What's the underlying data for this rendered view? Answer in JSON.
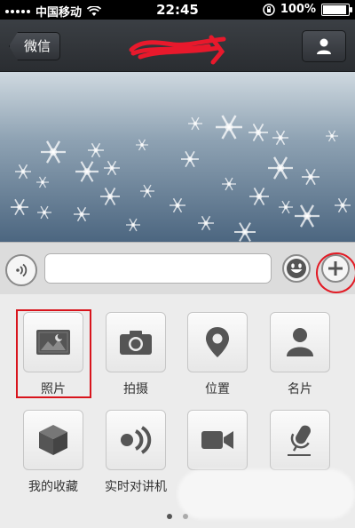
{
  "status_bar": {
    "carrier": "中国移动",
    "time": "22:45",
    "battery_percent": "100%",
    "battery_level": 1.0
  },
  "nav": {
    "back_label": "微信"
  },
  "input": {
    "placeholder": "",
    "value": ""
  },
  "panel": {
    "items": [
      {
        "label": "照片",
        "icon": "photo-icon"
      },
      {
        "label": "拍摄",
        "icon": "camera-icon"
      },
      {
        "label": "位置",
        "icon": "location-pin-icon"
      },
      {
        "label": "名片",
        "icon": "contact-card-icon"
      },
      {
        "label": "我的收藏",
        "icon": "favorites-cube-icon"
      },
      {
        "label": "实时对讲机",
        "icon": "walkie-talkie-icon"
      },
      {
        "label": "",
        "icon": "video-camera-icon"
      },
      {
        "label": "",
        "icon": "microphone-icon"
      }
    ],
    "page_count": 2,
    "current_page": 1
  },
  "colors": {
    "highlight_red": "#d8141c",
    "nav_bg": "#2f3237"
  }
}
